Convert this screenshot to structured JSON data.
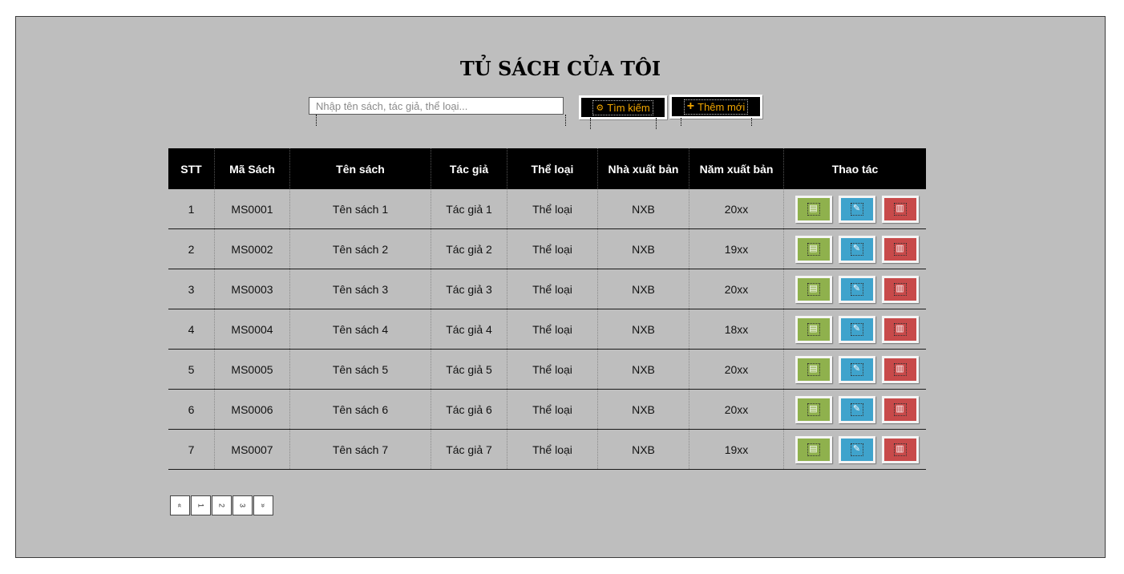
{
  "page": {
    "title": "TỦ SÁCH CỦA TÔI"
  },
  "search": {
    "placeholder": "Nhập tên sách, tác giả, thể loại...",
    "button_label": "Tìm kiếm"
  },
  "add": {
    "button_label": "Thêm mới"
  },
  "table": {
    "headers": [
      "STT",
      "Mã Sách",
      "Tên sách",
      "Tác giả",
      "Thể loại",
      "Nhà xuất bản",
      "Năm xuất bản",
      "Thao tác"
    ],
    "rows": [
      [
        "1",
        "MS0001",
        "Tên sách 1",
        "Tác giả 1",
        "Thể loại",
        "NXB",
        "20xx"
      ],
      [
        "2",
        "MS0002",
        "Tên sách 2",
        "Tác giả 2",
        "Thể loại",
        "NXB",
        "19xx"
      ],
      [
        "3",
        "MS0003",
        "Tên sách 3",
        "Tác giả 3",
        "Thể loại",
        "NXB",
        "20xx"
      ],
      [
        "4",
        "MS0004",
        "Tên sách 4",
        "Tác giả 4",
        "Thể loại",
        "NXB",
        "18xx"
      ],
      [
        "5",
        "MS0005",
        "Tên sách 5",
        "Tác giả 5",
        "Thể loại",
        "NXB",
        "20xx"
      ],
      [
        "6",
        "MS0006",
        "Tên sách 6",
        "Tác giả 6",
        "Thể loại",
        "NXB",
        "20xx"
      ],
      [
        "7",
        "MS0007",
        "Tên sách 7",
        "Tác giả 7",
        "Thể loại",
        "NXB",
        "19xx"
      ]
    ],
    "row_actions": [
      {
        "name": "view",
        "icon": "document-icon",
        "color": "#8fb14d"
      },
      {
        "name": "edit",
        "icon": "pencil-icon",
        "color": "#3fa3cc"
      },
      {
        "name": "delete",
        "icon": "trash-icon",
        "color": "#c84a4a"
      }
    ]
  },
  "pagination": {
    "pages": [
      "«",
      "1",
      "2",
      "3",
      "»"
    ]
  },
  "colors": {
    "background": "#bebebe",
    "header_bg": "#000000",
    "accent": "#f0a500"
  }
}
